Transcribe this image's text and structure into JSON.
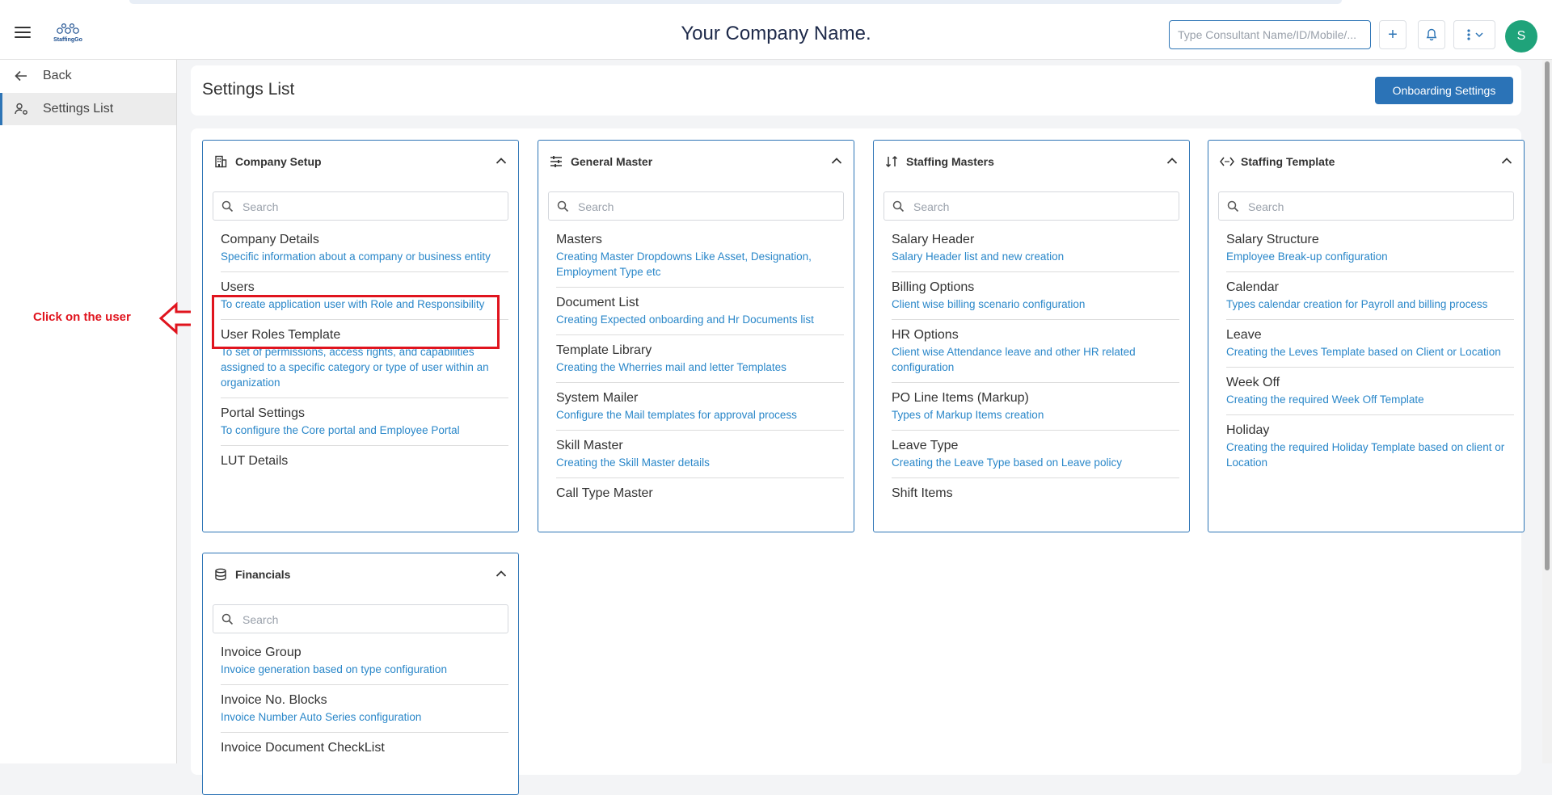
{
  "header": {
    "logo_text": "StaffingGo",
    "company_name": "Your Company Name.",
    "search_placeholder": "Type Consultant Name/ID/Mobile/...",
    "plus_label": "+",
    "avatar_initial": "S"
  },
  "sidebar": {
    "items": [
      {
        "label": "Back",
        "icon": "arrow-left-icon"
      },
      {
        "label": "Settings List",
        "icon": "user-settings-icon",
        "active": true
      }
    ]
  },
  "annotation": {
    "text": "Click on the user",
    "color": "#e0141e"
  },
  "page": {
    "title": "Settings List",
    "onboarding_button": "Onboarding Settings"
  },
  "colors": {
    "accent": "#2e75b6",
    "link": "#2a87c9",
    "avatar": "#1fa37a"
  },
  "cards": [
    {
      "title": "Company Setup",
      "icon": "building-icon",
      "search_placeholder": "Search",
      "items": [
        {
          "title": "Company Details",
          "desc": "Specific information about a company or business entity"
        },
        {
          "title": "Users",
          "desc": "To create application user with Role and Responsibility"
        },
        {
          "title": "User Roles Template",
          "desc": "To set of permissions, access rights, and capabilities assigned to a specific category or type of user within an organization"
        },
        {
          "title": "Portal Settings",
          "desc": "To configure the Core portal and Employee Portal"
        },
        {
          "title": "LUT Details",
          "desc": ""
        }
      ]
    },
    {
      "title": "General Master",
      "icon": "sliders-icon",
      "search_placeholder": "Search",
      "items": [
        {
          "title": "Masters",
          "desc": "Creating Master Dropdowns Like Asset, Designation, Employment Type etc"
        },
        {
          "title": "Document List",
          "desc": "Creating Expected onboarding and Hr Documents list"
        },
        {
          "title": "Template Library",
          "desc": "Creating the Wherries mail and letter Templates"
        },
        {
          "title": "System Mailer",
          "desc": "Configure the Mail templates for approval process"
        },
        {
          "title": "Skill Master",
          "desc": "Creating the Skill Master details"
        },
        {
          "title": "Call Type Master",
          "desc": ""
        }
      ]
    },
    {
      "title": "Staffing Masters",
      "icon": "sort-arrows-icon",
      "search_placeholder": "Search",
      "items": [
        {
          "title": "Salary Header",
          "desc": "Salary Header list and new creation"
        },
        {
          "title": "Billing Options",
          "desc": "Client wise billing scenario configuration"
        },
        {
          "title": "HR Options",
          "desc": "Client wise Attendance leave and other HR related configuration"
        },
        {
          "title": "PO Line Items (Markup)",
          "desc": "Types of Markup Items creation"
        },
        {
          "title": "Leave Type",
          "desc": "Creating the Leave Type based on Leave policy"
        },
        {
          "title": "Shift Items",
          "desc": ""
        }
      ]
    },
    {
      "title": "Staffing Template",
      "icon": "code-icon",
      "search_placeholder": "Search",
      "items": [
        {
          "title": "Salary Structure",
          "desc": "Employee Break-up configuration"
        },
        {
          "title": "Calendar",
          "desc": "Types calendar creation for Payroll and billing process"
        },
        {
          "title": "Leave",
          "desc": "Creating the Leves Template based on Client or Location"
        },
        {
          "title": "Week Off",
          "desc": "Creating the required Week Off Template"
        },
        {
          "title": "Holiday",
          "desc": "Creating the required Holiday Template based on client or Location"
        }
      ]
    },
    {
      "title": "Financials",
      "icon": "database-icon",
      "search_placeholder": "Search",
      "items": [
        {
          "title": "Invoice Group",
          "desc": "Invoice generation based on type configuration"
        },
        {
          "title": "Invoice No. Blocks",
          "desc": "Invoice Number Auto Series configuration"
        },
        {
          "title": "Invoice Document CheckList",
          "desc": ""
        }
      ]
    }
  ]
}
